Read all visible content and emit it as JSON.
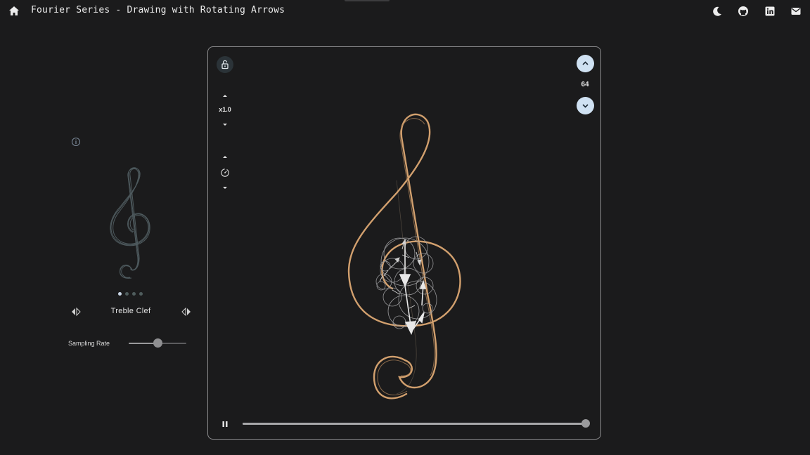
{
  "header": {
    "title": "Fourier Series - Drawing with Rotating Arrows",
    "icons": [
      "home-icon",
      "moon-icon",
      "github-icon",
      "linkedin-icon",
      "mail-icon"
    ]
  },
  "side_panel": {
    "info_icon": "info-icon",
    "shape_name": "Treble Clef",
    "carousel": {
      "count": 4,
      "active_index": 0
    },
    "sampling_rate": {
      "label": "Sampling Rate",
      "value_fraction": 0.5
    }
  },
  "canvas": {
    "speed_label": "x1.0",
    "arrow_count": "64",
    "progress_fraction": 1.0,
    "icons": [
      "lock-open-icon",
      "timer-icon",
      "pause-icon",
      "chevron-up-icon",
      "chevron-down-icon"
    ]
  },
  "colors": {
    "background": "#1b1b1c",
    "trace": "#d2a06e",
    "accent_button": "#cfe1f2",
    "arrows": "#e8e8e8"
  }
}
